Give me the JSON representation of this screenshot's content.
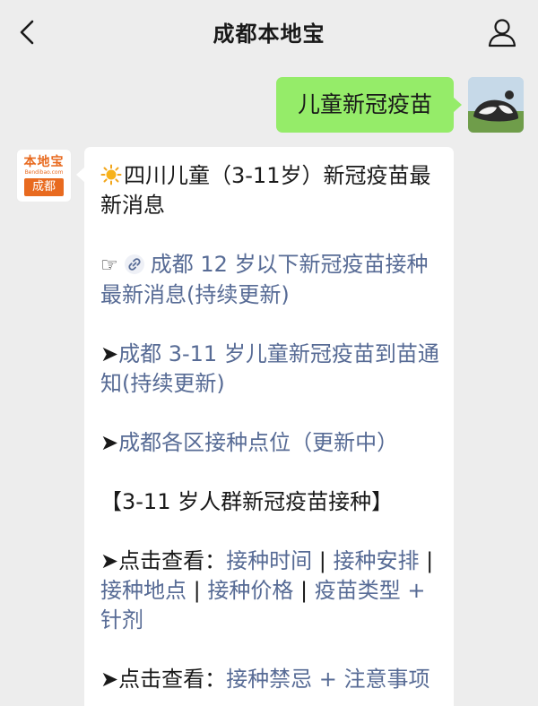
{
  "header": {
    "title": "成都本地宝"
  },
  "outgoing": {
    "text": "儿童新冠疫苗"
  },
  "bot_avatar": {
    "logo_text": "本地宝",
    "logo_url": "Bendibao.com",
    "logo_city": "成都"
  },
  "message": {
    "title": "四川儿童（3-11岁）新冠疫苗最新消息",
    "link1": "成都 12 岁以下新冠疫苗接种最新消息(持续更新)",
    "link2": "成都 3-11 岁儿童新冠疫苗到苗通知(持续更新)",
    "link3": "成都各区接种点位（更新中）",
    "section": "【3-11 岁人群新冠疫苗接种】",
    "check_label": "点击查看：",
    "check1": [
      "接种时间",
      "接种安排",
      "接种地点",
      "接种价格",
      "疫苗类型",
      "针剂"
    ],
    "check2": [
      "接种禁忌",
      "注意事项"
    ],
    "sep": "|",
    "plus": "+",
    "arrow": "➤",
    "hand": "☞"
  }
}
